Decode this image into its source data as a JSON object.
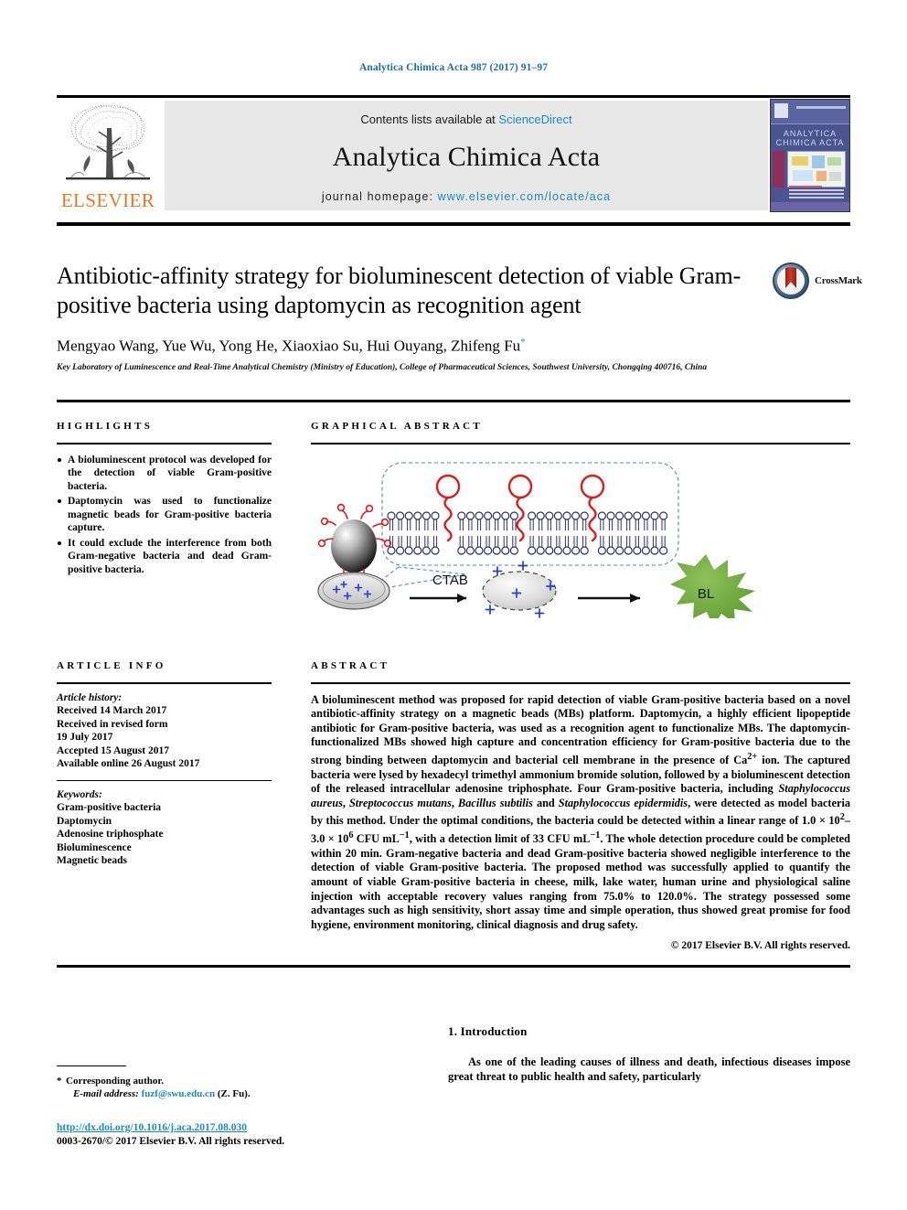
{
  "running_head": "Analytica Chimica Acta 987 (2017) 91–97",
  "masthead": {
    "contents_prefix": "Contents lists available at ",
    "sciencedirect": "ScienceDirect",
    "journal_name": "Analytica Chimica Acta",
    "homepage_prefix": "journal homepage: ",
    "homepage_url": "www.elsevier.com/locate/aca",
    "publisher": "ELSEVIER",
    "cover_title": "ANALYTICA CHIMICA ACTA",
    "link_color": "#1b8ac4",
    "publisher_color": "#e87722"
  },
  "article": {
    "title": "Antibiotic-affinity strategy for bioluminescent detection of viable Gram-positive bacteria using daptomycin as recognition agent",
    "authors": "Mengyao Wang, Yue Wu, Yong He, Xiaoxiao Su, Hui Ouyang, Zhifeng Fu",
    "corresponding_marker": "*",
    "affiliation": "Key Laboratory of Luminescence and Real-Time Analytical Chemistry (Ministry of Education), College of Pharmaceutical Sciences, Southwest University, Chongqing 400716, China",
    "crossmark_label": "CrossMark"
  },
  "highlights": {
    "heading": "HIGHLIGHTS",
    "items": [
      "A bioluminescent protocol was developed for the detection of viable Gram-positive bacteria.",
      "Daptomycin was used to functionalize magnetic beads for Gram-positive bacteria capture.",
      "It could exclude the interference from both Gram-negative bacteria and dead Gram-positive bacteria."
    ]
  },
  "graphical_abstract": {
    "heading": "GRAPHICAL ABSTRACT",
    "labels": {
      "reagent": "CTAB",
      "signal": "BL"
    },
    "colors": {
      "membrane": "#2a2f6b",
      "daptomycin": "#e01b1b",
      "bead": "#4d4d4d",
      "bl_star": "#6aa83a",
      "charge": "#2040d0",
      "callout": "#5588bb"
    }
  },
  "article_info": {
    "heading": "ARTICLE INFO",
    "history_label": "Article history:",
    "history": [
      "Received 14 March 2017",
      "Received in revised form",
      "19 July 2017",
      "Accepted 15 August 2017",
      "Available online 26 August 2017"
    ],
    "keywords_label": "Keywords:",
    "keywords": [
      "Gram-positive bacteria",
      "Daptomycin",
      "Adenosine triphosphate",
      "Bioluminescence",
      "Magnetic beads"
    ]
  },
  "abstract": {
    "heading": "ABSTRACT",
    "paragraph_parts": [
      {
        "t": "A bioluminescent method was proposed for rapid detection of viable Gram-positive bacteria based on a novel antibiotic-affinity strategy on a magnetic beads (MBs) platform. Daptomycin, a highly efficient lipopeptide antibiotic for Gram-positive bacteria, was used as a recognition agent to functionalize MBs. The daptomycin-functionalized MBs showed high capture and concentration efficiency for Gram-positive bacteria due to the strong binding between daptomycin and bacterial cell membrane in the presence of Ca"
      },
      {
        "t": "2+",
        "s": "sup"
      },
      {
        "t": " ion. The captured bacteria were lysed by hexadecyl trimethyl ammonium bromide solution, followed by a bioluminescent detection of the released intracellular adenosine triphosphate. Four Gram-positive bacteria, including "
      },
      {
        "t": "Staphylococcus aureus",
        "s": "i"
      },
      {
        "t": ", "
      },
      {
        "t": "Streptococcus mutans",
        "s": "i"
      },
      {
        "t": ", "
      },
      {
        "t": "Bacillus subtilis",
        "s": "i"
      },
      {
        "t": " and "
      },
      {
        "t": "Staphylococcus epidermidis",
        "s": "i"
      },
      {
        "t": ", were detected as model bacteria by this method. Under the optimal conditions, the bacteria could be detected within a linear range of 1.0 × 10"
      },
      {
        "t": "2",
        "s": "sup"
      },
      {
        "t": "–3.0 × 10"
      },
      {
        "t": "6",
        "s": "sup"
      },
      {
        "t": " CFU mL"
      },
      {
        "t": "−1",
        "s": "sup"
      },
      {
        "t": ", with a detection limit of 33 CFU mL"
      },
      {
        "t": "−1",
        "s": "sup"
      },
      {
        "t": ". The whole detection procedure could be completed within 20 min. Gram-negative bacteria and dead Gram-positive bacteria showed negligible interference to the detection of viable Gram-positive bacteria. The proposed method was successfully applied to quantify the amount of viable Gram-positive bacteria in cheese, milk, lake water, human urine and physiological saline injection with acceptable recovery values ranging from 75.0% to 120.0%. The strategy possessed some advantages such as high sensitivity, short assay time and simple operation, thus showed great promise for food hygiene, environment monitoring, clinical diagnosis and drug safety."
      }
    ],
    "copyright": "© 2017 Elsevier B.V. All rights reserved."
  },
  "introduction": {
    "heading": "1. Introduction",
    "body": "As one of the leading causes of illness and death, infectious diseases impose great threat to public health and safety, particularly"
  },
  "footer": {
    "corresponding_star": "*",
    "corresponding_label": "Corresponding author.",
    "email_label": "E-mail address:",
    "email": "fuzf@swu.edu.cn",
    "email_suffix": "(Z. Fu).",
    "doi": "http://dx.doi.org/10.1016/j.aca.2017.08.030",
    "issn_line": "0003-2670/© 2017 Elsevier B.V. All rights reserved."
  }
}
